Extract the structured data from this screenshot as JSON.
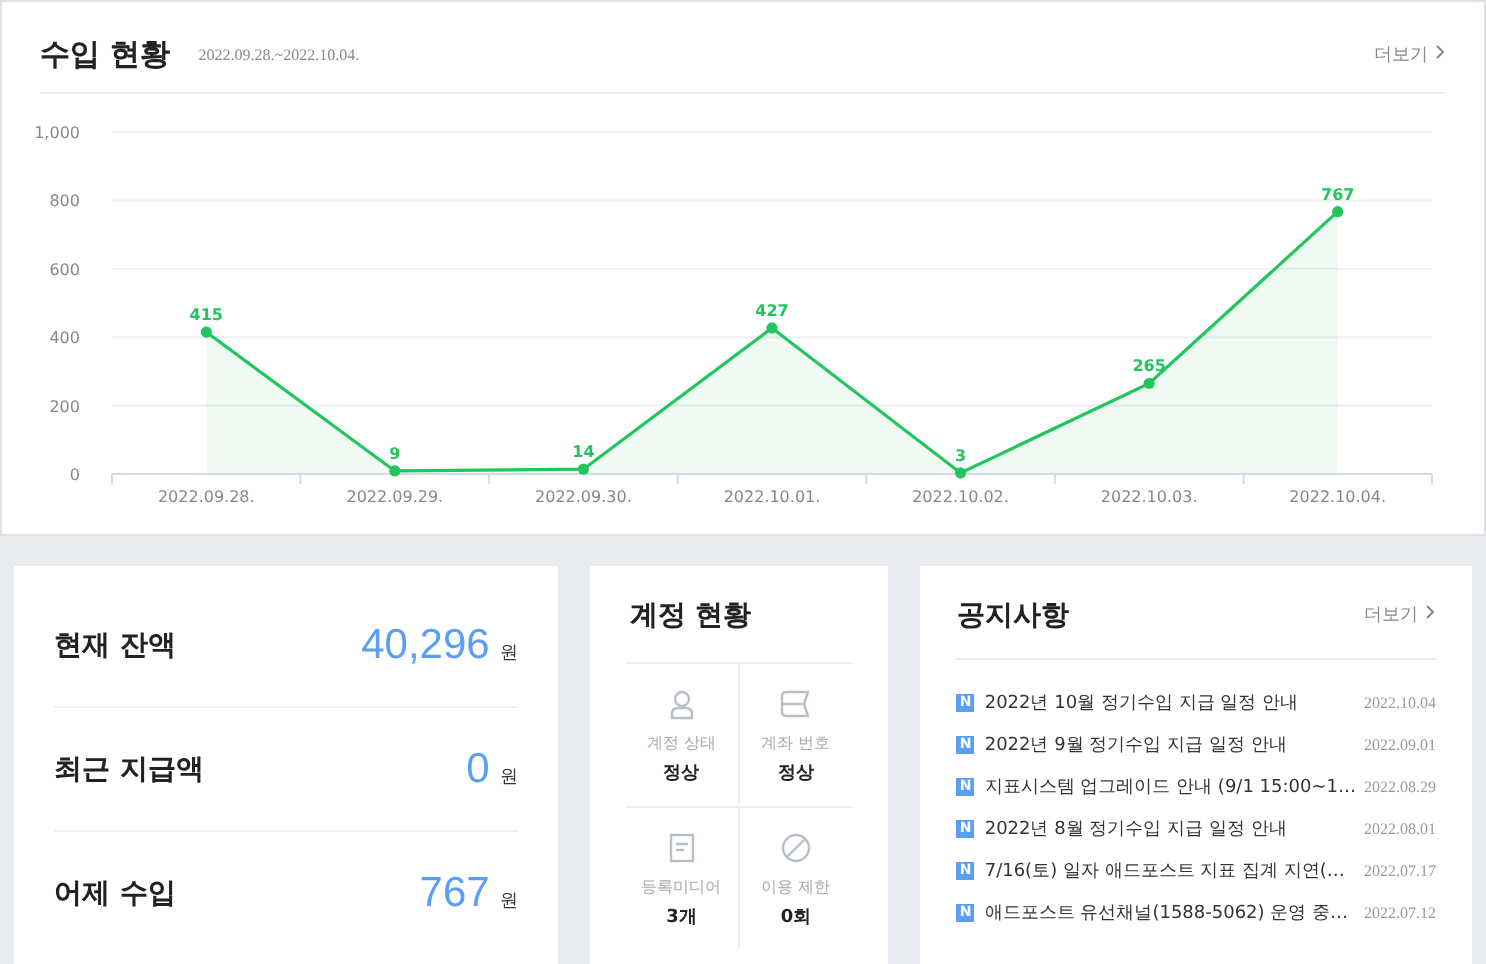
{
  "revenue": {
    "title": "수입 현황",
    "period": "2022.09.28.~2022.10.04.",
    "more": "더보기",
    "chart_data": {
      "type": "area",
      "categories": [
        "2022.09.28.",
        "2022.09.29.",
        "2022.09.30.",
        "2022.10.01.",
        "2022.10.02.",
        "2022.10.03.",
        "2022.10.04."
      ],
      "series": [
        {
          "color": "#22c55e",
          "values": [
            415,
            9,
            14,
            427,
            3,
            265,
            767
          ]
        }
      ],
      "ylim": [
        0,
        1000
      ],
      "yticks": [
        0,
        200,
        400,
        600,
        800,
        {
          "value": 1000,
          "label": "1,000"
        }
      ],
      "data_labels": true,
      "grid": true
    }
  },
  "balances": [
    {
      "label": "현재 잔액",
      "amount": "40,296",
      "unit": "원"
    },
    {
      "label": "최근 지급액",
      "amount": "0",
      "unit": "원"
    },
    {
      "label": "어제 수입",
      "amount": "767",
      "unit": "원"
    }
  ],
  "account": {
    "title": "계정 현황",
    "items": [
      {
        "kind": "person",
        "label": "계정 상태",
        "value": "정상"
      },
      {
        "kind": "flag",
        "label": "계좌 번호",
        "value": "정상"
      },
      {
        "kind": "document",
        "label": "등록미디어",
        "value": "3개"
      },
      {
        "kind": "blocked",
        "label": "이용 제한",
        "value": "0회"
      }
    ]
  },
  "notices": {
    "title": "공지사항",
    "more": "더보기",
    "items": [
      {
        "badge": "N",
        "text": "2022년 10월 정기수입 지급 일정 안내",
        "date": "2022.10.04"
      },
      {
        "badge": "N",
        "text": "2022년 9월 정기수입 지급 일정 안내",
        "date": "2022.09.01"
      },
      {
        "badge": "N",
        "text": "지표시스템 업그레이드 안내 (9/1 15:00~1…",
        "date": "2022.08.29"
      },
      {
        "badge": "N",
        "text": "2022년 8월 정기수입 지급 일정 안내",
        "date": "2022.08.01"
      },
      {
        "badge": "N",
        "text": "7/16(토) 일자 애드포스트 지표 집계 지연(…",
        "date": "2022.07.17"
      },
      {
        "badge": "N",
        "text": "애드포스트 유선채널(1588-5062) 운영 중…",
        "date": "2022.07.12"
      }
    ]
  }
}
